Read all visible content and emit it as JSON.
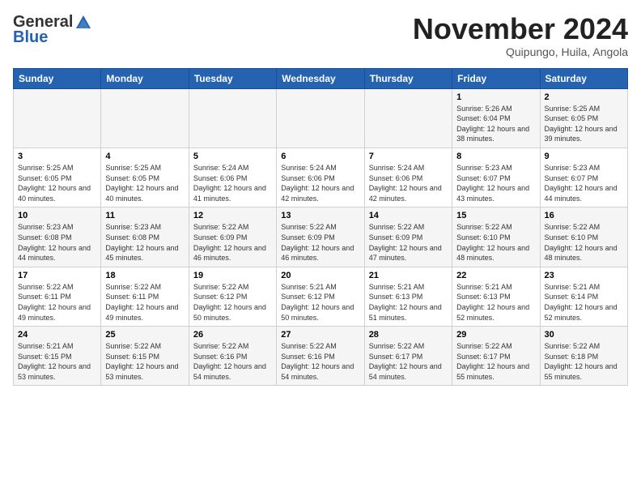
{
  "header": {
    "logo_general": "General",
    "logo_blue": "Blue",
    "month_title": "November 2024",
    "location": "Quipungo, Huila, Angola"
  },
  "calendar": {
    "weekdays": [
      "Sunday",
      "Monday",
      "Tuesday",
      "Wednesday",
      "Thursday",
      "Friday",
      "Saturday"
    ],
    "weeks": [
      [
        {
          "day": "",
          "info": ""
        },
        {
          "day": "",
          "info": ""
        },
        {
          "day": "",
          "info": ""
        },
        {
          "day": "",
          "info": ""
        },
        {
          "day": "",
          "info": ""
        },
        {
          "day": "1",
          "info": "Sunrise: 5:26 AM\nSunset: 6:04 PM\nDaylight: 12 hours and 38 minutes."
        },
        {
          "day": "2",
          "info": "Sunrise: 5:25 AM\nSunset: 6:05 PM\nDaylight: 12 hours and 39 minutes."
        }
      ],
      [
        {
          "day": "3",
          "info": "Sunrise: 5:25 AM\nSunset: 6:05 PM\nDaylight: 12 hours and 40 minutes."
        },
        {
          "day": "4",
          "info": "Sunrise: 5:25 AM\nSunset: 6:05 PM\nDaylight: 12 hours and 40 minutes."
        },
        {
          "day": "5",
          "info": "Sunrise: 5:24 AM\nSunset: 6:06 PM\nDaylight: 12 hours and 41 minutes."
        },
        {
          "day": "6",
          "info": "Sunrise: 5:24 AM\nSunset: 6:06 PM\nDaylight: 12 hours and 42 minutes."
        },
        {
          "day": "7",
          "info": "Sunrise: 5:24 AM\nSunset: 6:06 PM\nDaylight: 12 hours and 42 minutes."
        },
        {
          "day": "8",
          "info": "Sunrise: 5:23 AM\nSunset: 6:07 PM\nDaylight: 12 hours and 43 minutes."
        },
        {
          "day": "9",
          "info": "Sunrise: 5:23 AM\nSunset: 6:07 PM\nDaylight: 12 hours and 44 minutes."
        }
      ],
      [
        {
          "day": "10",
          "info": "Sunrise: 5:23 AM\nSunset: 6:08 PM\nDaylight: 12 hours and 44 minutes."
        },
        {
          "day": "11",
          "info": "Sunrise: 5:23 AM\nSunset: 6:08 PM\nDaylight: 12 hours and 45 minutes."
        },
        {
          "day": "12",
          "info": "Sunrise: 5:22 AM\nSunset: 6:09 PM\nDaylight: 12 hours and 46 minutes."
        },
        {
          "day": "13",
          "info": "Sunrise: 5:22 AM\nSunset: 6:09 PM\nDaylight: 12 hours and 46 minutes."
        },
        {
          "day": "14",
          "info": "Sunrise: 5:22 AM\nSunset: 6:09 PM\nDaylight: 12 hours and 47 minutes."
        },
        {
          "day": "15",
          "info": "Sunrise: 5:22 AM\nSunset: 6:10 PM\nDaylight: 12 hours and 48 minutes."
        },
        {
          "day": "16",
          "info": "Sunrise: 5:22 AM\nSunset: 6:10 PM\nDaylight: 12 hours and 48 minutes."
        }
      ],
      [
        {
          "day": "17",
          "info": "Sunrise: 5:22 AM\nSunset: 6:11 PM\nDaylight: 12 hours and 49 minutes."
        },
        {
          "day": "18",
          "info": "Sunrise: 5:22 AM\nSunset: 6:11 PM\nDaylight: 12 hours and 49 minutes."
        },
        {
          "day": "19",
          "info": "Sunrise: 5:22 AM\nSunset: 6:12 PM\nDaylight: 12 hours and 50 minutes."
        },
        {
          "day": "20",
          "info": "Sunrise: 5:21 AM\nSunset: 6:12 PM\nDaylight: 12 hours and 50 minutes."
        },
        {
          "day": "21",
          "info": "Sunrise: 5:21 AM\nSunset: 6:13 PM\nDaylight: 12 hours and 51 minutes."
        },
        {
          "day": "22",
          "info": "Sunrise: 5:21 AM\nSunset: 6:13 PM\nDaylight: 12 hours and 52 minutes."
        },
        {
          "day": "23",
          "info": "Sunrise: 5:21 AM\nSunset: 6:14 PM\nDaylight: 12 hours and 52 minutes."
        }
      ],
      [
        {
          "day": "24",
          "info": "Sunrise: 5:21 AM\nSunset: 6:15 PM\nDaylight: 12 hours and 53 minutes."
        },
        {
          "day": "25",
          "info": "Sunrise: 5:22 AM\nSunset: 6:15 PM\nDaylight: 12 hours and 53 minutes."
        },
        {
          "day": "26",
          "info": "Sunrise: 5:22 AM\nSunset: 6:16 PM\nDaylight: 12 hours and 54 minutes."
        },
        {
          "day": "27",
          "info": "Sunrise: 5:22 AM\nSunset: 6:16 PM\nDaylight: 12 hours and 54 minutes."
        },
        {
          "day": "28",
          "info": "Sunrise: 5:22 AM\nSunset: 6:17 PM\nDaylight: 12 hours and 54 minutes."
        },
        {
          "day": "29",
          "info": "Sunrise: 5:22 AM\nSunset: 6:17 PM\nDaylight: 12 hours and 55 minutes."
        },
        {
          "day": "30",
          "info": "Sunrise: 5:22 AM\nSunset: 6:18 PM\nDaylight: 12 hours and 55 minutes."
        }
      ]
    ]
  }
}
